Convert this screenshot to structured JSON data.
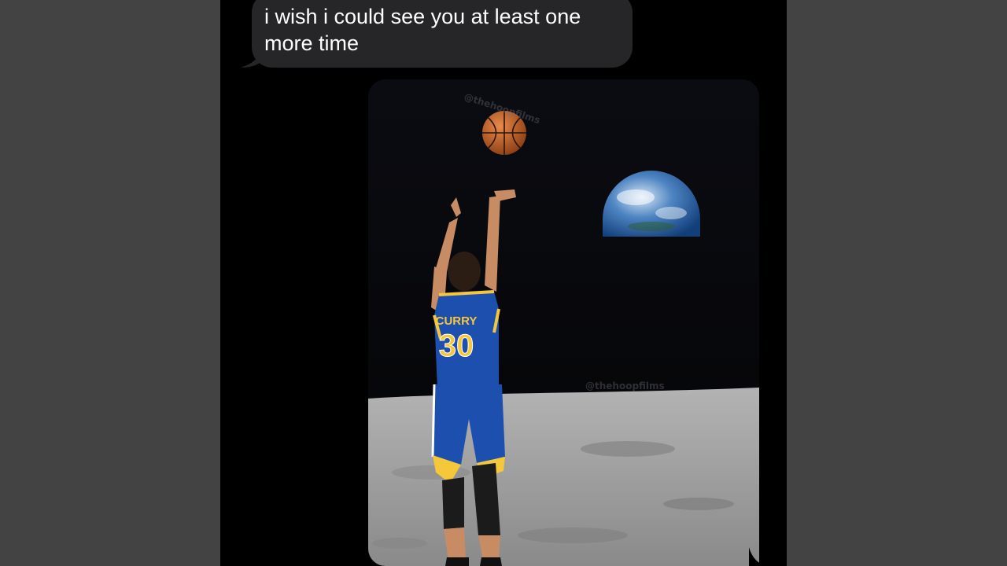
{
  "message": {
    "text": "i wish i could see you at least one more time"
  },
  "image": {
    "jersey_name": "CURRY",
    "jersey_number": "30",
    "watermark_top": "@thehoopfilms",
    "watermark_bottom": "@thehoopfilms"
  },
  "colors": {
    "background": "#434343",
    "screen": "#000000",
    "bubble": "#262628",
    "text": "#ffffff",
    "jersey": "#1d4fae",
    "jersey_trim": "#f5c73a",
    "moon": "#9c9c9c"
  },
  "icons": [
    "basketball-icon",
    "earth-icon"
  ]
}
